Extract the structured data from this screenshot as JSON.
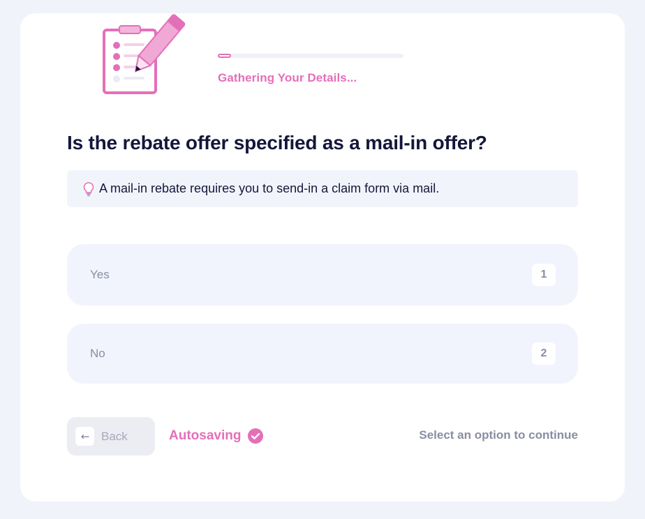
{
  "progress": {
    "label": "Gathering Your Details...",
    "fraction": 0.07
  },
  "question": {
    "title": "Is the rebate offer specified as a mail-in offer?",
    "hint": "A mail-in rebate requires you to send-in a claim form via mail.",
    "hint_icon": "lightbulb-icon"
  },
  "options": [
    {
      "label": "Yes",
      "key": "1"
    },
    {
      "label": "No",
      "key": "2"
    }
  ],
  "footer": {
    "back_label": "Back",
    "autosave_label": "Autosaving",
    "continue_hint": "Select an option to continue"
  },
  "colors": {
    "accent": "#e46fb9",
    "text_dark": "#14173a",
    "muted": "#8a8da3",
    "option_bg": "#f1f4fd",
    "page_bg": "#f1f3fa"
  }
}
